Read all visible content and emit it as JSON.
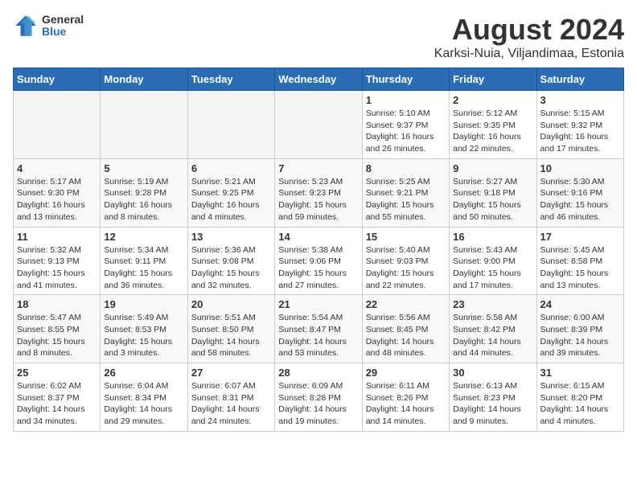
{
  "logo": {
    "general": "General",
    "blue": "Blue"
  },
  "title": {
    "month": "August 2024",
    "location": "Karksi-Nuia, Viljandimaa, Estonia"
  },
  "weekdays": [
    "Sunday",
    "Monday",
    "Tuesday",
    "Wednesday",
    "Thursday",
    "Friday",
    "Saturday"
  ],
  "weeks": [
    [
      {
        "day": "",
        "info": ""
      },
      {
        "day": "",
        "info": ""
      },
      {
        "day": "",
        "info": ""
      },
      {
        "day": "",
        "info": ""
      },
      {
        "day": "1",
        "info": "Sunrise: 5:10 AM\nSunset: 9:37 PM\nDaylight: 16 hours\nand 26 minutes."
      },
      {
        "day": "2",
        "info": "Sunrise: 5:12 AM\nSunset: 9:35 PM\nDaylight: 16 hours\nand 22 minutes."
      },
      {
        "day": "3",
        "info": "Sunrise: 5:15 AM\nSunset: 9:32 PM\nDaylight: 16 hours\nand 17 minutes."
      }
    ],
    [
      {
        "day": "4",
        "info": "Sunrise: 5:17 AM\nSunset: 9:30 PM\nDaylight: 16 hours\nand 13 minutes."
      },
      {
        "day": "5",
        "info": "Sunrise: 5:19 AM\nSunset: 9:28 PM\nDaylight: 16 hours\nand 8 minutes."
      },
      {
        "day": "6",
        "info": "Sunrise: 5:21 AM\nSunset: 9:25 PM\nDaylight: 16 hours\nand 4 minutes."
      },
      {
        "day": "7",
        "info": "Sunrise: 5:23 AM\nSunset: 9:23 PM\nDaylight: 15 hours\nand 59 minutes."
      },
      {
        "day": "8",
        "info": "Sunrise: 5:25 AM\nSunset: 9:21 PM\nDaylight: 15 hours\nand 55 minutes."
      },
      {
        "day": "9",
        "info": "Sunrise: 5:27 AM\nSunset: 9:18 PM\nDaylight: 15 hours\nand 50 minutes."
      },
      {
        "day": "10",
        "info": "Sunrise: 5:30 AM\nSunset: 9:16 PM\nDaylight: 15 hours\nand 46 minutes."
      }
    ],
    [
      {
        "day": "11",
        "info": "Sunrise: 5:32 AM\nSunset: 9:13 PM\nDaylight: 15 hours\nand 41 minutes."
      },
      {
        "day": "12",
        "info": "Sunrise: 5:34 AM\nSunset: 9:11 PM\nDaylight: 15 hours\nand 36 minutes."
      },
      {
        "day": "13",
        "info": "Sunrise: 5:36 AM\nSunset: 9:08 PM\nDaylight: 15 hours\nand 32 minutes."
      },
      {
        "day": "14",
        "info": "Sunrise: 5:38 AM\nSunset: 9:06 PM\nDaylight: 15 hours\nand 27 minutes."
      },
      {
        "day": "15",
        "info": "Sunrise: 5:40 AM\nSunset: 9:03 PM\nDaylight: 15 hours\nand 22 minutes."
      },
      {
        "day": "16",
        "info": "Sunrise: 5:43 AM\nSunset: 9:00 PM\nDaylight: 15 hours\nand 17 minutes."
      },
      {
        "day": "17",
        "info": "Sunrise: 5:45 AM\nSunset: 8:58 PM\nDaylight: 15 hours\nand 13 minutes."
      }
    ],
    [
      {
        "day": "18",
        "info": "Sunrise: 5:47 AM\nSunset: 8:55 PM\nDaylight: 15 hours\nand 8 minutes."
      },
      {
        "day": "19",
        "info": "Sunrise: 5:49 AM\nSunset: 8:53 PM\nDaylight: 15 hours\nand 3 minutes."
      },
      {
        "day": "20",
        "info": "Sunrise: 5:51 AM\nSunset: 8:50 PM\nDaylight: 14 hours\nand 58 minutes."
      },
      {
        "day": "21",
        "info": "Sunrise: 5:54 AM\nSunset: 8:47 PM\nDaylight: 14 hours\nand 53 minutes."
      },
      {
        "day": "22",
        "info": "Sunrise: 5:56 AM\nSunset: 8:45 PM\nDaylight: 14 hours\nand 48 minutes."
      },
      {
        "day": "23",
        "info": "Sunrise: 5:58 AM\nSunset: 8:42 PM\nDaylight: 14 hours\nand 44 minutes."
      },
      {
        "day": "24",
        "info": "Sunrise: 6:00 AM\nSunset: 8:39 PM\nDaylight: 14 hours\nand 39 minutes."
      }
    ],
    [
      {
        "day": "25",
        "info": "Sunrise: 6:02 AM\nSunset: 8:37 PM\nDaylight: 14 hours\nand 34 minutes."
      },
      {
        "day": "26",
        "info": "Sunrise: 6:04 AM\nSunset: 8:34 PM\nDaylight: 14 hours\nand 29 minutes."
      },
      {
        "day": "27",
        "info": "Sunrise: 6:07 AM\nSunset: 8:31 PM\nDaylight: 14 hours\nand 24 minutes."
      },
      {
        "day": "28",
        "info": "Sunrise: 6:09 AM\nSunset: 8:28 PM\nDaylight: 14 hours\nand 19 minutes."
      },
      {
        "day": "29",
        "info": "Sunrise: 6:11 AM\nSunset: 8:26 PM\nDaylight: 14 hours\nand 14 minutes."
      },
      {
        "day": "30",
        "info": "Sunrise: 6:13 AM\nSunset: 8:23 PM\nDaylight: 14 hours\nand 9 minutes."
      },
      {
        "day": "31",
        "info": "Sunrise: 6:15 AM\nSunset: 8:20 PM\nDaylight: 14 hours\nand 4 minutes."
      }
    ]
  ]
}
